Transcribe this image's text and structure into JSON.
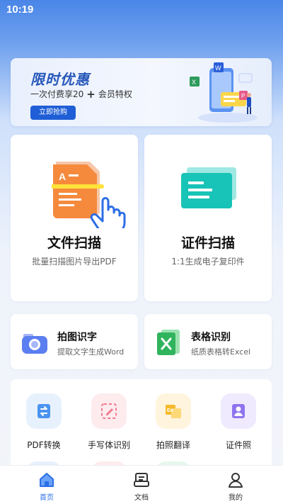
{
  "status_bar": {
    "time": "10:19"
  },
  "promo": {
    "title": "限时优惠",
    "subtitle_left": "一次付费享20",
    "subtitle_plus": "+",
    "subtitle_right": "会员特权",
    "button_label": "立即抢购",
    "colors": {
      "title": "#2456b9",
      "button": "#1f5ed6"
    }
  },
  "big_cards": [
    {
      "title": "文件扫描",
      "subtitle": "批量扫描图片导出PDF",
      "icon": "document-scan-icon"
    },
    {
      "title": "证件扫描",
      "subtitle": "1:1生成电子复印件",
      "icon": "id-card-icon"
    }
  ],
  "mid_cards": [
    {
      "title": "拍图识字",
      "subtitle": "提取文字生成Word",
      "icon": "camera-icon"
    },
    {
      "title": "表格识别",
      "subtitle": "纸质表格转Excel",
      "icon": "excel-icon"
    }
  ],
  "tools": [
    {
      "label": "PDF转换",
      "icon": "pdf-convert-icon"
    },
    {
      "label": "手写体识别",
      "icon": "handwriting-icon"
    },
    {
      "label": "拍照翻译",
      "icon": "translate-icon"
    },
    {
      "label": "证件照",
      "icon": "id-photo-icon"
    }
  ],
  "tabbar": {
    "items": [
      {
        "label": "首页",
        "icon": "home-icon",
        "active": true
      },
      {
        "label": "文档",
        "icon": "documents-icon",
        "active": false
      },
      {
        "label": "我的",
        "icon": "profile-icon",
        "active": false
      }
    ],
    "active_color": "#2c6ee8"
  }
}
